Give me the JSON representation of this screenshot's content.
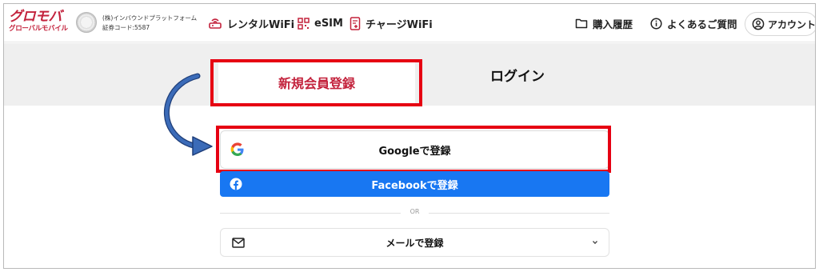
{
  "header": {
    "logo": {
      "line1": "グロモバ",
      "line2": "グローバルモバイル"
    },
    "corp": {
      "name": "(株)インバウンドプラットフォーム",
      "code": "証券コード:5587"
    },
    "nav": [
      {
        "label": "レンタルWiFi",
        "icon": "router-icon"
      },
      {
        "label": "eSIM",
        "icon": "qr-code-icon"
      },
      {
        "label": "チャージWiFi",
        "icon": "charge-icon"
      }
    ],
    "right": {
      "history": "購入履歴",
      "faq": "よくあるご質問",
      "account": "アカウント"
    }
  },
  "tabs": {
    "signup": "新規会員登録",
    "login": "ログイン"
  },
  "auth": {
    "google": "Googleで登録",
    "facebook": "Facebookで登録",
    "or": "OR",
    "email": "メールで登録"
  },
  "colors": {
    "brand": "#c3223c",
    "highlight": "#e60012",
    "facebook": "#1877f2",
    "arrow": "#3b6bb8"
  }
}
